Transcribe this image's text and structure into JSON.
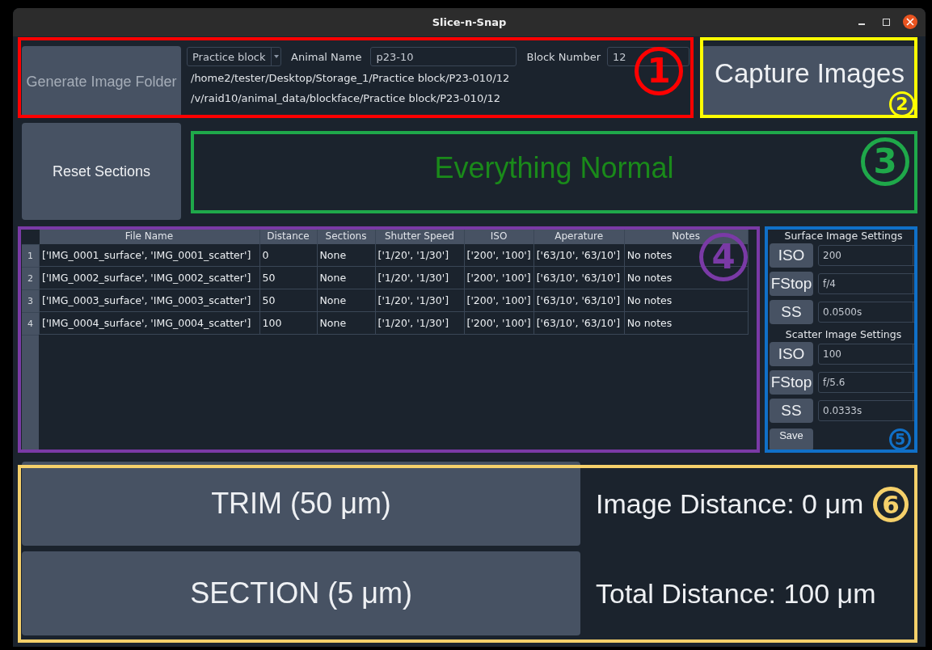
{
  "window": {
    "title": "Slice-n-Snap"
  },
  "folder": {
    "button": "Generate Image Folder",
    "block_type": "Practice block",
    "animal_name": {
      "label": "Animal Name",
      "value": "p23-10"
    },
    "block_number": {
      "label": "Block Number",
      "value": "12"
    },
    "paths": [
      "/home2/tester/Desktop/Storage_1/Practice block/P23-010/12",
      "/v/raid10/animal_data/blockface/Practice block/P23-010/12"
    ]
  },
  "capture_button": "Capture Images",
  "reset_button": "Reset Sections",
  "status": "Everything Normal",
  "table": {
    "columns": [
      "File Name",
      "Distance",
      "Sections",
      "Shutter Speed",
      "ISO",
      "Aperature",
      "Notes"
    ],
    "rows": [
      {
        "number": "1",
        "cells": [
          "['IMG_0001_surface', 'IMG_0001_scatter']",
          "0",
          "None",
          "['1/20', '1/30']",
          "['200', '100']",
          "['63/10', '63/10']",
          "No notes"
        ]
      },
      {
        "number": "2",
        "cells": [
          "['IMG_0002_surface', 'IMG_0002_scatter']",
          "50",
          "None",
          "['1/20', '1/30']",
          "['200', '100']",
          "['63/10', '63/10']",
          "No notes"
        ]
      },
      {
        "number": "3",
        "cells": [
          "['IMG_0003_surface', 'IMG_0003_scatter']",
          "50",
          "None",
          "['1/20', '1/30']",
          "['200', '100']",
          "['63/10', '63/10']",
          "No notes"
        ]
      },
      {
        "number": "4",
        "cells": [
          "['IMG_0004_surface', 'IMG_0004_scatter']",
          "100",
          "None",
          "['1/20', '1/30']",
          "['200', '100']",
          "['63/10', '63/10']",
          "No notes"
        ]
      }
    ]
  },
  "settings": [
    {
      "title": "Surface Image Settings",
      "rows": [
        {
          "button": "ISO",
          "value": "200"
        },
        {
          "button": "FStop",
          "value": "f/4"
        },
        {
          "button": "SS",
          "value": "0.0500s"
        }
      ]
    },
    {
      "title": "Scatter Image Settings",
      "rows": [
        {
          "button": "ISO",
          "value": "100"
        },
        {
          "button": "FStop",
          "value": "f/5.6"
        },
        {
          "button": "SS",
          "value": "0.0333s"
        }
      ]
    }
  ],
  "save_button": "Save",
  "trim_button": "TRIM (50 μm)",
  "section_button": "SECTION (5 μm)",
  "image_distance": "Image Distance: 0 μm",
  "total_distance": "Total Distance: 100 μm",
  "annotations": [
    {
      "number": "1",
      "color": "#ff0000"
    },
    {
      "number": "2",
      "color": "#ffff00"
    },
    {
      "number": "3",
      "color": "#1fa84a"
    },
    {
      "number": "4",
      "color": "#7a3aa6"
    },
    {
      "number": "5",
      "color": "#1070c8"
    },
    {
      "number": "6",
      "color": "#f5d06a"
    }
  ]
}
